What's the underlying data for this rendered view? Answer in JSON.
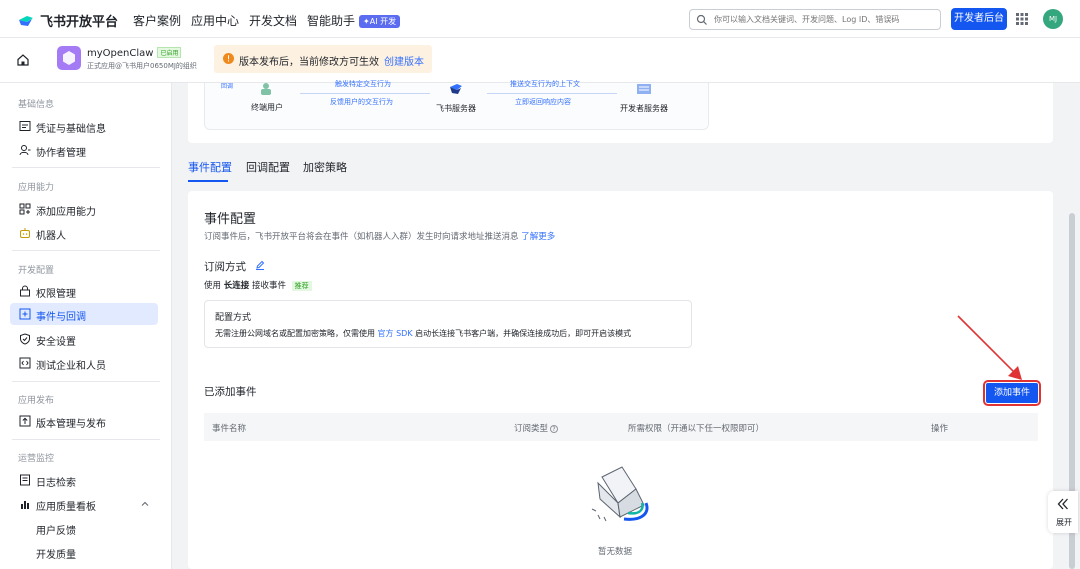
{
  "colors": {
    "brand": "#1456f0",
    "active_bg": "#e1eaff",
    "link": "#3370ff",
    "annotation": "#e03434"
  },
  "topnav": {
    "logo_text": "飞书开放平台",
    "links": [
      "客户案例",
      "应用中心",
      "开发文档",
      "智能助手"
    ],
    "ai_badge": "✦AI 开发",
    "search_placeholder": "你可以输入文档关键词、开发问题、Log ID、错误码",
    "dev_console": "开发者后台",
    "avatar": "MJ",
    "icons": [
      "search-icon",
      "grid-icon"
    ]
  },
  "app": {
    "name": "myOpenClaw",
    "status": "已启用",
    "subtitle": "正式应用@飞书用户0650MJ的组织",
    "notice": "版本发布后，当前修改方可生效",
    "notice_action": "创建版本"
  },
  "sidebar": {
    "sections": [
      {
        "title": "基础信息",
        "items": [
          "凭证与基础信息",
          "协作者管理"
        ]
      },
      {
        "title": "应用能力",
        "items": [
          "添加应用能力",
          "机器人"
        ]
      },
      {
        "title": "开发配置",
        "items": [
          "权限管理",
          "事件与回调",
          "安全设置",
          "测试企业和人员"
        ]
      },
      {
        "title": "应用发布",
        "items": [
          "版本管理与发布"
        ]
      },
      {
        "title": "运营监控",
        "items": [
          "日志检索",
          "应用质量看板",
          "用户反馈",
          "开发质量"
        ]
      }
    ],
    "active": "事件与回调"
  },
  "flow": {
    "nodes": [
      "终端用户",
      "飞书服务器",
      "开发者服务器"
    ],
    "arrows": [
      "触发特定交互行为",
      "反馈用户的交互行为",
      "推送交互行为的上下文",
      "立即返回响应内容"
    ],
    "top_tag": "回调"
  },
  "tabs": [
    "事件配置",
    "回调配置",
    "加密策略"
  ],
  "event_config": {
    "title": "事件配置",
    "desc": "订阅事件后，飞书开放平台将会在事件（如机器人入群）发生时向请求地址推送消息",
    "learn_more": "了解更多",
    "sub_mode_title": "订阅方式",
    "use_prefix": "使用",
    "use_mode": "长连接",
    "use_suffix": "接收事件",
    "recommended": "推荐",
    "config_box_title": "配置方式",
    "config_desc_pre": "无需注册公网域名或配置加密策略，仅需使用",
    "config_desc_link": "官方 SDK",
    "config_desc_post": "启动长连接飞书客户端，并确保连接成功后，即可开启该模式",
    "added_title": "已添加事件",
    "add_button": "添加事件",
    "columns": [
      "事件名称",
      "订阅类型",
      "所需权限（开通以下任一权限即可）",
      "操作"
    ],
    "empty": "暂无数据"
  },
  "expand": {
    "label": "展开"
  }
}
